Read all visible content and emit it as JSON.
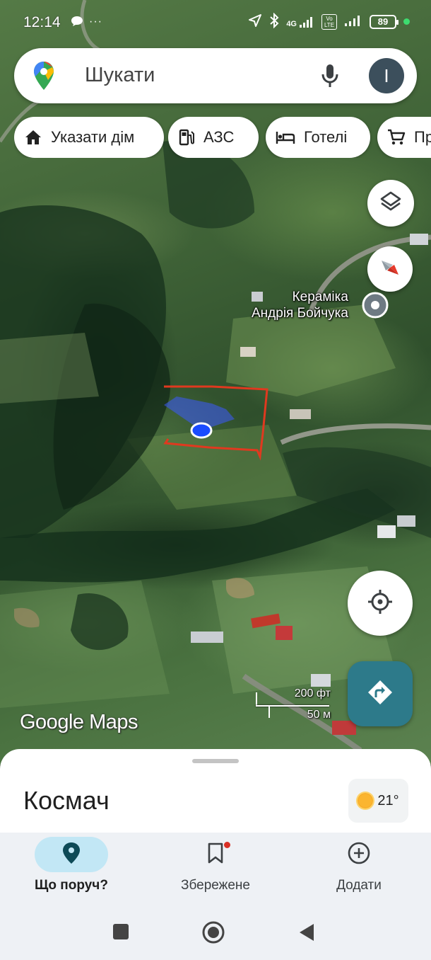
{
  "status_bar": {
    "time": "12:14",
    "notification_icons": [
      "chat-bubble-icon",
      "more-dots-icon"
    ],
    "signal_label": "4G",
    "volte_label": "Vo LTE",
    "battery": "89"
  },
  "search": {
    "placeholder": "Шукати",
    "avatar_letter": "I"
  },
  "chips": [
    {
      "label": "Указати дім",
      "icon": "home-icon"
    },
    {
      "label": "АЗС",
      "icon": "gas-station-icon"
    },
    {
      "label": "Готелі",
      "icon": "hotel-icon"
    },
    {
      "label": "Пр",
      "icon": "shopping-cart-icon"
    }
  ],
  "map": {
    "poi_label_line1": "Кераміка",
    "poi_label_line2": "Андрія Бойчука",
    "logo": "Google Maps",
    "scale_imperial": "200 фт",
    "scale_metric": "50 м",
    "colors": {
      "user_location": "#1a4cff",
      "drawn_outline": "#e0391f",
      "directions_button": "#2d7a8a"
    }
  },
  "sheet": {
    "place_title": "Космач",
    "temperature": "21°"
  },
  "bottom_nav": [
    {
      "label": "Що поруч?",
      "icon": "location-pin-icon",
      "active": true
    },
    {
      "label": "Збережене",
      "icon": "bookmark-icon",
      "active": false
    },
    {
      "label": "Додати",
      "icon": "add-circle-icon",
      "active": false
    }
  ]
}
